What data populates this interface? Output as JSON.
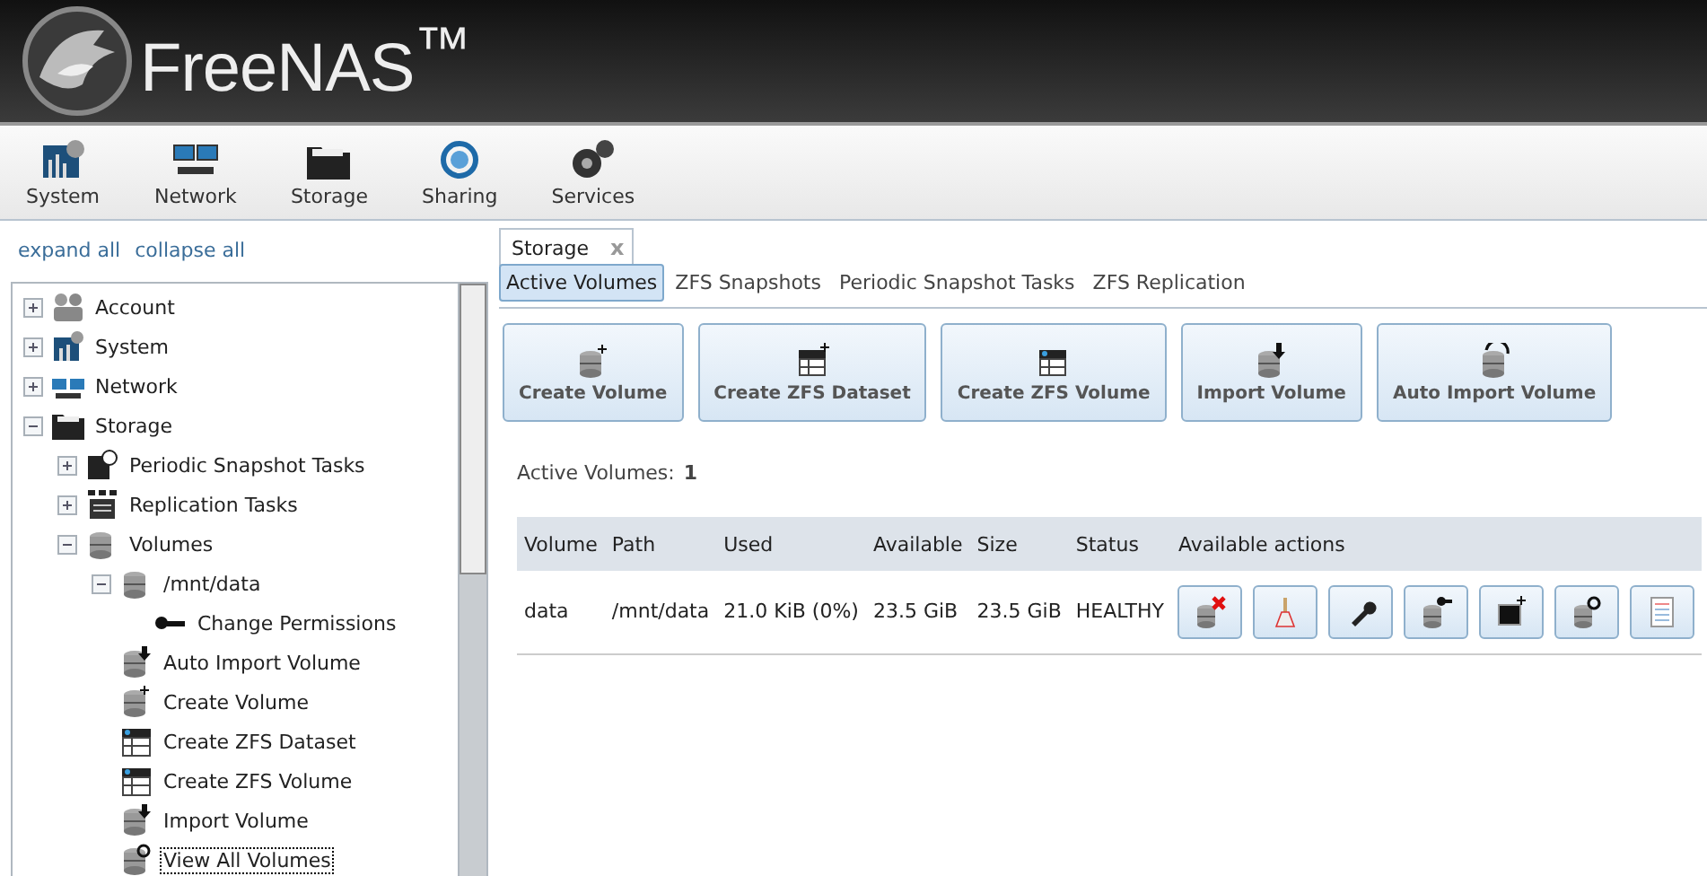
{
  "header": {
    "logo_text": "FreeNAS$^{™}$"
  },
  "toolbar": [
    {
      "label": "System"
    },
    {
      "label": "Network"
    },
    {
      "label": "Storage"
    },
    {
      "label": "Sharing"
    },
    {
      "label": "Services"
    }
  ],
  "tree_links": [
    "expand all",
    "collapse all"
  ],
  "tree": [
    {
      "label": "Account",
      "expanded": false
    },
    {
      "label": "System",
      "expanded": false
    },
    {
      "label": "Network",
      "expanded": false
    },
    {
      "label": "Storage",
      "expanded": true,
      "children": [
        {
          "label": "Periodic Snapshot Tasks",
          "expanded": false
        },
        {
          "label": "Replication Tasks",
          "expanded": false
        },
        {
          "label": "Volumes",
          "expanded": true,
          "children": [
            {
              "label": "/mnt/data",
              "expanded": true,
              "children": [
                {
                  "label": "Change Permissions"
                }
              ]
            },
            {
              "label": "Auto Import Volume"
            },
            {
              "label": "Create Volume"
            },
            {
              "label": "Create ZFS Dataset"
            },
            {
              "label": "Create ZFS Volume"
            },
            {
              "label": "Import Volume"
            },
            {
              "label": "View All Volumes",
              "focused": true
            }
          ]
        }
      ]
    }
  ],
  "main_tab": {
    "label": "Storage",
    "close": "x"
  },
  "subtabs": [
    {
      "label": "Active Volumes",
      "selected": true
    },
    {
      "label": "ZFS Snapshots",
      "selected": false
    },
    {
      "label": "Periodic Snapshot Tasks",
      "selected": false
    },
    {
      "label": "ZFS Replication",
      "selected": false
    }
  ],
  "action_buttons": [
    "Create Volume",
    "Create ZFS Dataset",
    "Create ZFS Volume",
    "Import Volume",
    "Auto Import Volume"
  ],
  "summary": {
    "label": "Active Volumes:",
    "count": "1"
  },
  "table": {
    "columns": [
      "Volume",
      "Path",
      "Used",
      "Available",
      "Size",
      "Status",
      "Available actions"
    ],
    "rows": [
      {
        "cells": [
          "data",
          "/mnt/data",
          "21.0 KiB (0%)",
          "23.5 GiB",
          "23.5 GiB",
          "HEALTHY"
        ]
      }
    ]
  }
}
